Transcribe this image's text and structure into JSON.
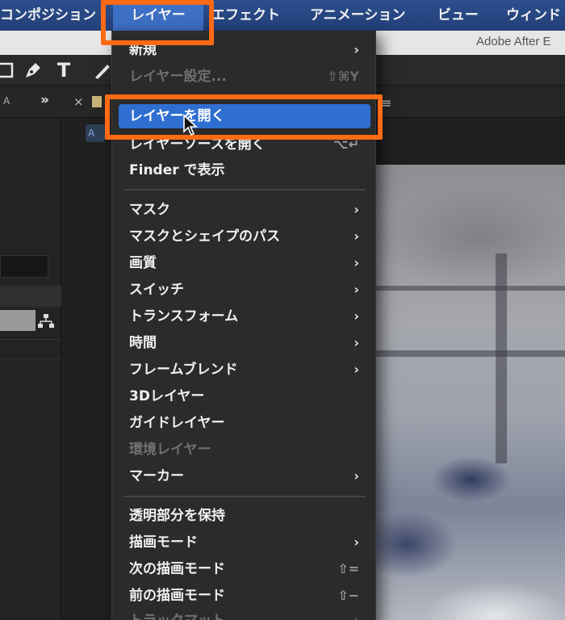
{
  "menubar": {
    "composition": "コンポジション",
    "layer": "レイヤー",
    "effect": "エフェクト",
    "animation": "アニメーション",
    "view": "ビュー",
    "window": "ウィンド"
  },
  "app_title": "Adobe After E",
  "toolbar": {
    "text_tool": "T"
  },
  "left_panel": {
    "tab_label": "A",
    "expand": "»"
  },
  "comp_panel": {
    "close": "×",
    "subbar_label": "A",
    "menu_icon": "≡"
  },
  "menu": {
    "new": {
      "label": "新規",
      "arrow": "›"
    },
    "layer_settings": {
      "label": "レイヤー設定...",
      "shortcut": "⇧⌘Y"
    },
    "open_layer": {
      "label": "レイヤーを開く"
    },
    "open_layer_source": {
      "label": "レイヤーソースを開く",
      "shortcut": "⌥↵"
    },
    "reveal_in_finder": {
      "label": "Finder で表示"
    },
    "mask": {
      "label": "マスク",
      "arrow": "›"
    },
    "mask_shape_path": {
      "label": "マスクとシェイプのパス",
      "arrow": "›"
    },
    "quality": {
      "label": "画質",
      "arrow": "›"
    },
    "switches": {
      "label": "スイッチ",
      "arrow": "›"
    },
    "transform": {
      "label": "トランスフォーム",
      "arrow": "›"
    },
    "time": {
      "label": "時間",
      "arrow": "›"
    },
    "frame_blending": {
      "label": "フレームブレンド",
      "arrow": "›"
    },
    "layer_3d": {
      "label": "3Dレイヤー"
    },
    "guide_layer": {
      "label": "ガイドレイヤー"
    },
    "environment_layer": {
      "label": "環境レイヤー"
    },
    "markers": {
      "label": "マーカー",
      "arrow": "›"
    },
    "preserve_transparency": {
      "label": "透明部分を保持"
    },
    "blending_mode": {
      "label": "描画モード",
      "arrow": "›"
    },
    "next_blending_mode": {
      "label": "次の描画モード",
      "shortcut": "⇧="
    },
    "prev_blending_mode": {
      "label": "前の描画モード",
      "shortcut": "⇧−"
    },
    "track_matte": {
      "label": "トラックマット",
      "arrow": "›"
    }
  },
  "colors": {
    "menubar": "#2c4f8e",
    "menu_highlight": "#2f6fd1",
    "annotation_orange": "#ff6a14",
    "menu_background": "#2b2b2c"
  }
}
